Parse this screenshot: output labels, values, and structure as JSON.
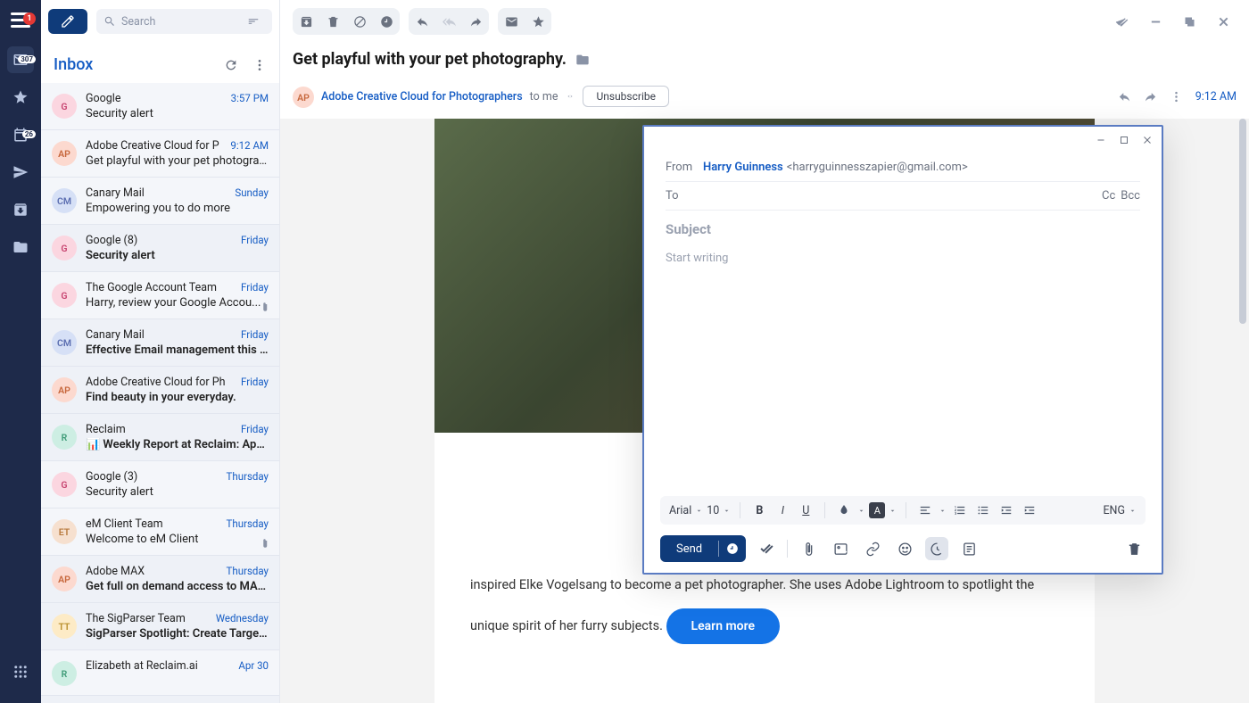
{
  "rail": {
    "hamburger_badge": "1",
    "inbox_count": "307",
    "calendar_count": "26"
  },
  "search": {
    "placeholder": "Search"
  },
  "folder": {
    "title": "Inbox"
  },
  "avatarColors": {
    "G": {
      "bg": "#fbd6e0",
      "fg": "#c74571"
    },
    "AP": {
      "bg": "#fcd9cf",
      "fg": "#c6663b"
    },
    "CM": {
      "bg": "#d6e0f6",
      "fg": "#5a6db0"
    },
    "R": {
      "bg": "#cdeee3",
      "fg": "#3e9b77"
    },
    "ET": {
      "bg": "#f6e0cf",
      "fg": "#b87a3d"
    },
    "TT": {
      "bg": "#fdebc6",
      "fg": "#b9902f"
    }
  },
  "messages": [
    {
      "initials": "G",
      "from": "Google",
      "count": "",
      "time": "3:57 PM",
      "subject": "Security alert",
      "unread": false,
      "selected": false,
      "attachment": false
    },
    {
      "initials": "AP",
      "from": "Adobe Creative Cloud for P",
      "count": "",
      "time": "9:12 AM",
      "subject": "Get playful with your pet photograp...",
      "unread": false,
      "selected": true,
      "attachment": false
    },
    {
      "initials": "CM",
      "from": "Canary Mail",
      "count": "",
      "time": "Sunday",
      "subject": "Empowering you to do more",
      "unread": false,
      "selected": false,
      "attachment": false
    },
    {
      "initials": "G",
      "from": "Google",
      "count": "(8)",
      "time": "Friday",
      "subject": "Security alert",
      "unread": true,
      "selected": false,
      "attachment": false
    },
    {
      "initials": "G",
      "from": "The Google Account Team",
      "count": "",
      "time": "Friday",
      "subject": "Harry, review your Google Accou...",
      "unread": false,
      "selected": false,
      "attachment": true
    },
    {
      "initials": "CM",
      "from": "Canary Mail",
      "count": "",
      "time": "Friday",
      "subject": "Effective Email management this w...",
      "unread": true,
      "selected": false,
      "attachment": false
    },
    {
      "initials": "AP",
      "from": "Adobe Creative Cloud for Ph",
      "count": "",
      "time": "Friday",
      "subject": "Find beauty in your everyday.",
      "unread": true,
      "selected": false,
      "attachment": false
    },
    {
      "initials": "R",
      "from": "Reclaim",
      "count": "",
      "time": "Friday",
      "subject": "📊 Weekly Report at Reclaim: Apr 2...",
      "unread": true,
      "selected": false,
      "attachment": false
    },
    {
      "initials": "G",
      "from": "Google",
      "count": "(3)",
      "time": "Thursday",
      "subject": "Security alert",
      "unread": false,
      "selected": false,
      "attachment": false
    },
    {
      "initials": "ET",
      "from": "eM Client Team",
      "count": "",
      "time": "Thursday",
      "subject": "Welcome to eM Client",
      "unread": false,
      "selected": false,
      "attachment": true
    },
    {
      "initials": "AP",
      "from": "Adobe MAX",
      "count": "",
      "time": "Thursday",
      "subject": "Get full on demand access to MAX...",
      "unread": true,
      "selected": false,
      "attachment": false
    },
    {
      "initials": "TT",
      "from": "The SigParser Team",
      "count": "",
      "time": "Wednesday",
      "subject": "SigParser Spotlight: Create Targete...",
      "unread": true,
      "selected": false,
      "attachment": false
    },
    {
      "initials": "R",
      "from": "Elizabeth at Reclaim.ai",
      "count": "",
      "time": "Apr 30",
      "subject": "",
      "unread": false,
      "selected": false,
      "attachment": false
    }
  ],
  "email": {
    "subject": "Get playful with your pet photography.",
    "sender": "Adobe Creative Cloud for Photographers",
    "recipient": "to me",
    "unsubscribe": "Unsubscribe",
    "time": "9:12 AM",
    "body_tail": "inspired Elke Vogelsang to become a pet photographer. She uses Adobe Lightroom to spotlight the unique spirit of her furry subjects.",
    "learn_more": "Learn more"
  },
  "compose": {
    "from_label": "From",
    "from_name": "Harry Guinness",
    "from_email": "<harryguinnesszapier@gmail.com>",
    "to_label": "To",
    "cc": "Cc",
    "bcc": "Bcc",
    "subject_placeholder": "Subject",
    "body_placeholder": "Start writing",
    "font": "Arial",
    "size": "10",
    "lang": "ENG",
    "send": "Send"
  }
}
